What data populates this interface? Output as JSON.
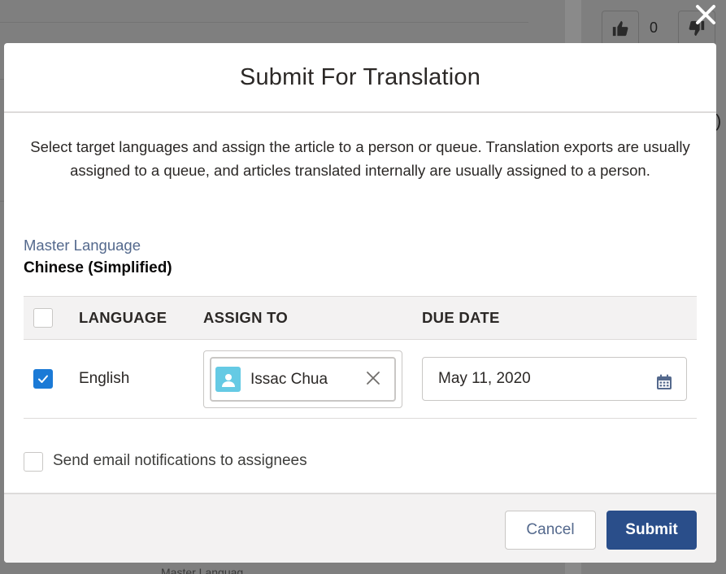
{
  "background": {
    "like_count": "0",
    "paren_text": ")",
    "partial_text": "Master Languag"
  },
  "modal": {
    "title": "Submit For Translation",
    "intro": "Select target languages and assign the article to a person or queue. Translation exports are usually assigned to a queue, and articles translated internally are usually assigned to a person.",
    "master_language_label": "Master Language",
    "master_language_value": "Chinese (Simplified)",
    "table": {
      "headers": {
        "language": "LANGUAGE",
        "assign_to": "ASSIGN TO",
        "due_date": "DUE DATE"
      },
      "rows": [
        {
          "checked": true,
          "language": "English",
          "assignee": "Issac Chua",
          "due_date": "May 11, 2020"
        }
      ]
    },
    "notify_label": "Send email notifications to assignees",
    "buttons": {
      "cancel": "Cancel",
      "submit": "Submit"
    }
  },
  "colors": {
    "brand_button": "#2a4e8a",
    "checkbox_checked": "#1b7ad6",
    "avatar": "#65cae4"
  }
}
